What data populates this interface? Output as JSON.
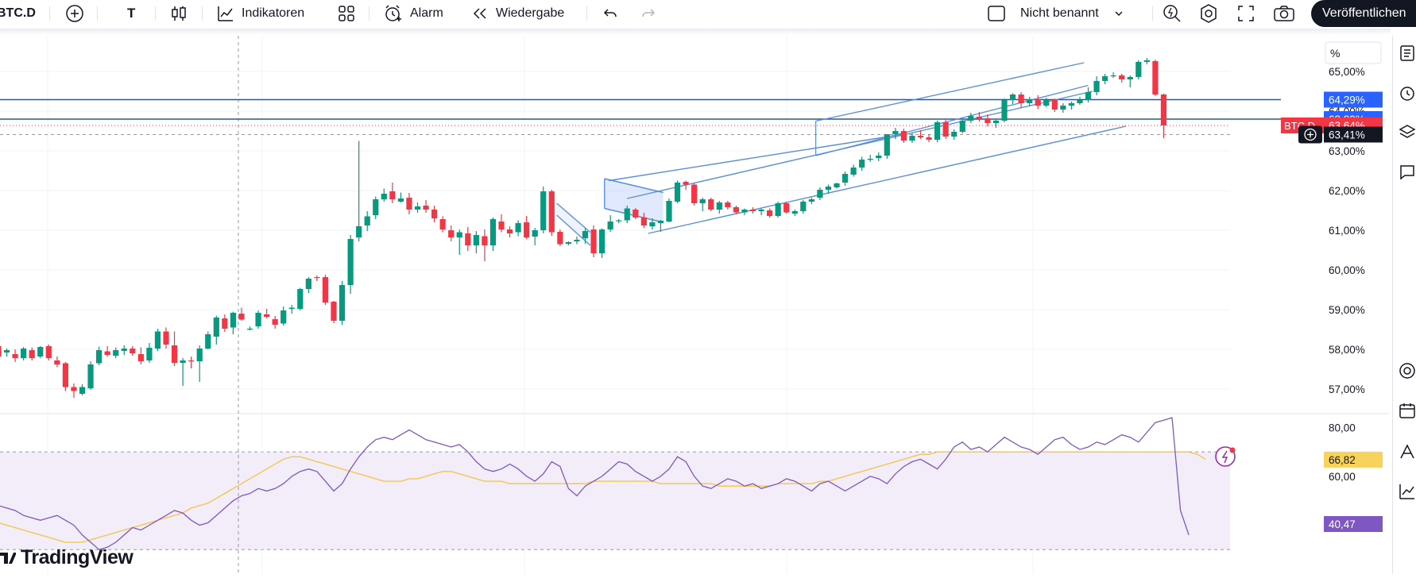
{
  "toolbar": {
    "symbol": "BTC.D",
    "text_tool": "T",
    "indicators_label": "Indikatoren",
    "alarm_label": "Alarm",
    "replay_label": "Wiedergabe",
    "layout_name": "Nicht benannt",
    "publish_label": "Veröffentlichen"
  },
  "price_axis": {
    "unit": "%",
    "ticks": [
      "65,00%",
      "64,00%",
      "63,00%",
      "62,00%",
      "61,00%",
      "60,00%",
      "59,00%",
      "58,00%",
      "57,00%"
    ],
    "badges": [
      {
        "text": "64,29%",
        "color": "#2962ff"
      },
      {
        "text": "63,80%",
        "color": "#2962ff"
      },
      {
        "text": "63,64%",
        "color": "#f23645"
      },
      {
        "text": "63,41%",
        "color": "#131722"
      }
    ],
    "symbol_tag": "BTC.D"
  },
  "rsi_axis": {
    "ticks": [
      "80,00",
      "60,00"
    ],
    "badges": [
      {
        "text": "66,82",
        "color": "#f7d35c"
      },
      {
        "text": "40,47",
        "color": "#7e57c2"
      }
    ]
  },
  "watermark": {
    "text": "TradingView"
  },
  "colors": {
    "up": "#089981",
    "down": "#f23645",
    "channel": "#5b8fd9",
    "hline": "#2153c4",
    "rsi": "#7e57c2",
    "rsi_ma": "#f6c443"
  },
  "chart_data": {
    "type": "candlestick",
    "ylim": [
      56.5,
      65.6
    ],
    "candles": [
      [
        58.08,
        58.15,
        57.72,
        57.82
      ],
      [
        57.92,
        58.02,
        57.82,
        57.98
      ],
      [
        57.88,
        58.0,
        57.68,
        57.78
      ],
      [
        57.78,
        58.06,
        57.72,
        58.02
      ],
      [
        57.98,
        58.05,
        57.72,
        57.78
      ],
      [
        57.82,
        58.08,
        57.78,
        58.06
      ],
      [
        58.08,
        58.12,
        57.72,
        57.78
      ],
      [
        57.72,
        57.82,
        57.55,
        57.62
      ],
      [
        57.65,
        57.68,
        56.95,
        57.05
      ],
      [
        57.05,
        57.14,
        56.78,
        56.95
      ],
      [
        56.88,
        57.12,
        56.84,
        57.05
      ],
      [
        57.02,
        57.7,
        56.98,
        57.62
      ],
      [
        57.65,
        58.07,
        57.6,
        57.98
      ],
      [
        57.95,
        58.08,
        57.82,
        57.86
      ],
      [
        57.84,
        58.05,
        57.78,
        57.98
      ],
      [
        57.96,
        58.1,
        57.86,
        58.02
      ],
      [
        58.02,
        58.08,
        57.84,
        57.9
      ],
      [
        57.88,
        58.05,
        57.62,
        57.7
      ],
      [
        57.72,
        58.16,
        57.66,
        58.04
      ],
      [
        58.02,
        58.52,
        57.96,
        58.45
      ],
      [
        58.45,
        58.55,
        58.02,
        58.12
      ],
      [
        58.1,
        58.45,
        57.58,
        57.66
      ],
      [
        57.66,
        57.78,
        57.08,
        57.72
      ],
      [
        57.72,
        57.82,
        57.52,
        57.7
      ],
      [
        57.7,
        58.1,
        57.18,
        58.02
      ],
      [
        58.02,
        58.45,
        58.0,
        58.38
      ],
      [
        58.32,
        58.85,
        58.12,
        58.8
      ],
      [
        58.78,
        58.88,
        58.44,
        58.52
      ],
      [
        58.55,
        58.95,
        58.38,
        58.92
      ],
      [
        58.9,
        59.05,
        58.72,
        58.75
      ],
      [
        58.52,
        58.58,
        58.48,
        58.52
      ],
      [
        58.58,
        58.98,
        58.52,
        58.92
      ],
      [
        58.88,
        59.02,
        58.78,
        58.82
      ],
      [
        58.76,
        58.84,
        58.52,
        58.62
      ],
      [
        58.65,
        59.08,
        58.6,
        58.98
      ],
      [
        59.02,
        59.12,
        58.9,
        59.05
      ],
      [
        59.02,
        59.55,
        58.98,
        59.52
      ],
      [
        59.52,
        59.82,
        59.42,
        59.78
      ],
      [
        59.82,
        59.86,
        59.72,
        59.8
      ],
      [
        59.82,
        59.88,
        59.12,
        59.18
      ],
      [
        59.2,
        59.22,
        58.66,
        58.72
      ],
      [
        58.72,
        59.72,
        58.62,
        59.62
      ],
      [
        59.62,
        60.88,
        59.4,
        60.78
      ],
      [
        60.82,
        63.25,
        60.72,
        61.1
      ],
      [
        61.12,
        61.48,
        60.98,
        61.35
      ],
      [
        61.38,
        61.85,
        61.28,
        61.78
      ],
      [
        61.78,
        62.05,
        61.72,
        61.92
      ],
      [
        61.98,
        62.2,
        61.68,
        61.78
      ],
      [
        61.72,
        61.95,
        61.7,
        61.8
      ],
      [
        61.82,
        61.94,
        61.4,
        61.52
      ],
      [
        61.52,
        61.7,
        61.44,
        61.6
      ],
      [
        61.62,
        61.76,
        61.44,
        61.52
      ],
      [
        61.52,
        61.62,
        61.2,
        61.3
      ],
      [
        61.28,
        61.35,
        60.95,
        61.02
      ],
      [
        61.0,
        61.12,
        60.72,
        60.82
      ],
      [
        60.82,
        61.02,
        60.38,
        60.95
      ],
      [
        60.92,
        61.08,
        60.48,
        60.62
      ],
      [
        60.62,
        60.98,
        60.42,
        60.88
      ],
      [
        60.85,
        61.02,
        60.22,
        60.62
      ],
      [
        60.62,
        61.32,
        60.48,
        61.28
      ],
      [
        61.22,
        61.4,
        60.95,
        61.02
      ],
      [
        61.02,
        61.1,
        60.82,
        60.92
      ],
      [
        60.95,
        61.25,
        60.85,
        61.18
      ],
      [
        61.2,
        61.36,
        60.78,
        60.82
      ],
      [
        60.84,
        61.06,
        60.62,
        61.0
      ],
      [
        61.0,
        62.1,
        60.92,
        61.98
      ],
      [
        61.98,
        62.02,
        60.86,
        60.95
      ],
      [
        60.96,
        61.02,
        60.6,
        60.65
      ],
      [
        60.66,
        60.72,
        60.62,
        60.7
      ],
      [
        60.72,
        60.84,
        60.65,
        60.76
      ],
      [
        60.8,
        61.05,
        60.66,
        60.98
      ],
      [
        61.02,
        61.12,
        60.32,
        60.42
      ],
      [
        60.42,
        61.05,
        60.3,
        61.02
      ],
      [
        61.02,
        61.38,
        60.96,
        61.22
      ],
      [
        61.24,
        61.28,
        61.18,
        61.25
      ],
      [
        61.25,
        61.62,
        61.18,
        61.55
      ],
      [
        61.52,
        61.56,
        61.28,
        61.32
      ],
      [
        61.32,
        61.44,
        61.06,
        61.12
      ],
      [
        61.1,
        61.3,
        61.02,
        61.2
      ],
      [
        61.18,
        61.26,
        60.96,
        61.24
      ],
      [
        61.22,
        61.8,
        61.2,
        61.74
      ],
      [
        61.72,
        62.25,
        61.68,
        62.2
      ],
      [
        62.22,
        62.25,
        62.02,
        62.15
      ],
      [
        62.15,
        62.18,
        61.62,
        61.68
      ],
      [
        61.68,
        61.82,
        61.48,
        61.78
      ],
      [
        61.78,
        61.82,
        61.48,
        61.52
      ],
      [
        61.52,
        61.74,
        61.42,
        61.7
      ],
      [
        61.7,
        61.74,
        61.52,
        61.58
      ],
      [
        61.58,
        61.62,
        61.4,
        61.45
      ],
      [
        61.45,
        61.55,
        61.38,
        61.52
      ],
      [
        61.52,
        61.58,
        61.42,
        61.48
      ],
      [
        61.48,
        61.55,
        61.38,
        61.52
      ],
      [
        61.5,
        61.55,
        61.32,
        61.36
      ],
      [
        61.36,
        61.72,
        61.32,
        61.68
      ],
      [
        61.68,
        61.72,
        61.42,
        61.45
      ],
      [
        61.42,
        61.52,
        61.36,
        61.48
      ],
      [
        61.48,
        61.76,
        61.42,
        61.72
      ],
      [
        61.72,
        61.82,
        61.66,
        61.78
      ],
      [
        61.82,
        62.08,
        61.76,
        62.02
      ],
      [
        62.02,
        62.15,
        61.92,
        62.1
      ],
      [
        62.08,
        62.2,
        62.05,
        62.18
      ],
      [
        62.2,
        62.48,
        62.12,
        62.42
      ],
      [
        62.4,
        62.65,
        62.35,
        62.58
      ],
      [
        62.58,
        62.85,
        62.5,
        62.78
      ],
      [
        62.78,
        62.9,
        62.72,
        62.8
      ],
      [
        62.82,
        62.96,
        62.74,
        62.88
      ],
      [
        62.88,
        63.18,
        62.8,
        63.42
      ],
      [
        63.42,
        63.58,
        63.3,
        63.5
      ],
      [
        63.5,
        63.56,
        63.2,
        63.26
      ],
      [
        63.26,
        63.44,
        63.2,
        63.38
      ],
      [
        63.38,
        63.52,
        63.3,
        63.34
      ],
      [
        63.34,
        63.42,
        63.22,
        63.28
      ],
      [
        63.28,
        63.76,
        63.22,
        63.72
      ],
      [
        63.72,
        63.78,
        63.3,
        63.36
      ],
      [
        63.36,
        63.54,
        63.28,
        63.48
      ],
      [
        63.48,
        63.82,
        63.44,
        63.76
      ],
      [
        63.76,
        63.96,
        63.7,
        63.88
      ],
      [
        63.86,
        63.98,
        63.74,
        63.8
      ],
      [
        63.82,
        63.92,
        63.62,
        63.7
      ],
      [
        63.7,
        63.8,
        63.58,
        63.76
      ],
      [
        63.76,
        64.32,
        63.72,
        64.28
      ],
      [
        64.28,
        64.45,
        64.18,
        64.42
      ],
      [
        64.42,
        64.48,
        64.08,
        64.2
      ],
      [
        64.2,
        64.36,
        64.12,
        64.3
      ],
      [
        64.3,
        64.4,
        64.05,
        64.14
      ],
      [
        64.14,
        64.34,
        64.1,
        64.28
      ],
      [
        64.28,
        64.32,
        63.98,
        64.04
      ],
      [
        64.04,
        64.2,
        63.96,
        64.14
      ],
      [
        64.14,
        64.24,
        64.04,
        64.2
      ],
      [
        64.2,
        64.36,
        64.16,
        64.28
      ],
      [
        64.28,
        64.6,
        64.22,
        64.48
      ],
      [
        64.48,
        64.88,
        64.4,
        64.76
      ],
      [
        64.76,
        64.94,
        64.68,
        64.88
      ],
      [
        64.88,
        64.98,
        64.84,
        64.9
      ],
      [
        64.9,
        64.94,
        64.72,
        64.8
      ],
      [
        64.8,
        64.9,
        64.6,
        64.86
      ],
      [
        64.86,
        65.28,
        64.8,
        65.24
      ],
      [
        65.24,
        65.34,
        65.18,
        65.28
      ],
      [
        65.26,
        65.3,
        64.38,
        64.42
      ],
      [
        64.42,
        64.44,
        63.32,
        63.64
      ]
    ],
    "horizontal_lines": [
      64.29,
      63.8
    ],
    "rsi": {
      "ylim": [
        20,
        85
      ],
      "upper": 70,
      "lower": 30,
      "values": [
        48,
        47,
        46,
        44,
        43,
        42,
        43,
        44,
        42,
        40,
        36,
        33,
        30,
        31,
        33,
        36,
        39,
        38,
        40,
        42,
        44,
        46,
        45,
        42,
        40,
        41,
        44,
        47,
        50,
        52,
        53,
        55,
        54,
        55,
        57,
        60,
        62,
        63,
        62,
        58,
        54,
        57,
        63,
        68,
        72,
        75,
        76,
        75,
        77,
        79,
        77,
        75,
        74,
        73,
        72,
        73,
        70,
        66,
        63,
        62,
        63,
        65,
        63,
        60,
        58,
        61,
        66,
        64,
        55,
        52,
        56,
        58,
        60,
        63,
        66,
        65,
        62,
        60,
        58,
        60,
        63,
        68,
        66,
        60,
        56,
        55,
        57,
        59,
        58,
        56,
        57,
        55,
        56,
        57,
        59,
        58,
        56,
        54,
        57,
        58,
        56,
        54,
        56,
        58,
        60,
        59,
        57,
        61,
        64,
        66,
        67,
        65,
        63,
        67,
        72,
        74,
        71,
        72,
        70,
        73,
        76,
        74,
        72,
        71,
        69,
        72,
        75,
        76,
        73,
        71,
        72,
        74,
        73,
        75,
        77,
        76,
        74,
        78,
        82,
        83,
        84,
        46,
        36
      ],
      "ma_values": [
        41,
        40,
        39,
        38,
        37,
        36,
        35,
        34,
        33,
        33,
        33,
        34,
        35,
        36,
        37,
        38,
        39,
        40,
        41,
        42,
        43,
        44,
        45,
        47,
        48,
        49,
        51,
        53,
        55,
        57,
        59,
        61,
        63,
        65,
        67,
        68,
        68,
        67,
        66,
        65,
        64,
        63,
        62,
        61,
        60,
        59,
        58,
        58,
        58,
        59,
        59,
        60,
        61,
        62,
        62,
        61,
        60,
        59,
        58,
        58,
        58,
        57,
        57,
        57,
        57,
        57,
        57,
        57,
        57,
        57,
        57,
        58,
        58,
        58,
        58,
        58,
        58,
        58,
        58,
        57,
        57,
        57,
        57,
        57,
        57,
        57,
        56,
        56,
        56,
        56,
        56,
        56,
        56,
        57,
        57,
        57,
        57,
        57,
        58,
        58,
        59,
        60,
        61,
        62,
        63,
        64,
        65,
        66,
        67,
        68,
        69,
        69,
        70,
        70,
        70,
        70,
        70,
        70,
        70,
        70,
        70,
        70,
        70,
        70,
        70,
        70,
        70,
        70,
        70,
        70,
        70,
        70,
        70,
        70,
        70,
        70,
        70,
        70,
        70,
        70,
        70,
        70,
        70,
        69,
        67
      ]
    }
  }
}
